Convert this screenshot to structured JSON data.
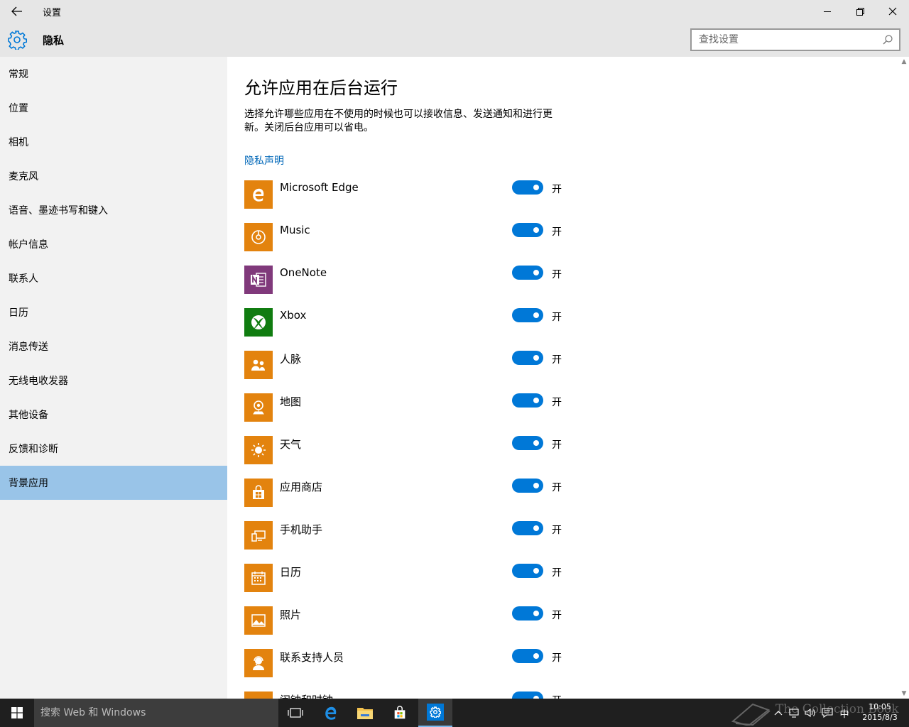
{
  "titlebar": {
    "title": "设置"
  },
  "header": {
    "section_title": "隐私",
    "search_placeholder": "查找设置"
  },
  "sidebar": {
    "items": [
      {
        "label": "常规",
        "active": false
      },
      {
        "label": "位置",
        "active": false
      },
      {
        "label": "相机",
        "active": false
      },
      {
        "label": "麦克风",
        "active": false
      },
      {
        "label": "语音、墨迹书写和键入",
        "active": false
      },
      {
        "label": "帐户信息",
        "active": false
      },
      {
        "label": "联系人",
        "active": false
      },
      {
        "label": "日历",
        "active": false
      },
      {
        "label": "消息传送",
        "active": false
      },
      {
        "label": "无线电收发器",
        "active": false
      },
      {
        "label": "其他设备",
        "active": false
      },
      {
        "label": "反馈和诊断",
        "active": false
      },
      {
        "label": "背景应用",
        "active": true
      }
    ]
  },
  "main": {
    "title": "允许应用在后台运行",
    "description": "选择允许哪些应用在不使用的时候也可以接收信息、发送通知和进行更新。关闭后台应用可以省电。",
    "privacy_link": "隐私声明",
    "on_label": "开",
    "apps": [
      {
        "name": "Microsoft Edge",
        "icon": "edge-icon",
        "color": "#e3830e",
        "on": true
      },
      {
        "name": "Music",
        "icon": "music-icon",
        "color": "#e3830e",
        "on": true
      },
      {
        "name": "OneNote",
        "icon": "onenote-icon",
        "color": "#80397b",
        "on": true
      },
      {
        "name": "Xbox",
        "icon": "xbox-icon",
        "color": "#107c10",
        "on": true
      },
      {
        "name": "人脉",
        "icon": "people-icon",
        "color": "#e3830e",
        "on": true
      },
      {
        "name": "地图",
        "icon": "maps-icon",
        "color": "#e3830e",
        "on": true
      },
      {
        "name": "天气",
        "icon": "weather-icon",
        "color": "#e3830e",
        "on": true
      },
      {
        "name": "应用商店",
        "icon": "store-icon",
        "color": "#e3830e",
        "on": true
      },
      {
        "name": "手机助手",
        "icon": "phone-companion-icon",
        "color": "#e3830e",
        "on": true
      },
      {
        "name": "日历",
        "icon": "calendar-icon",
        "color": "#e3830e",
        "on": true
      },
      {
        "name": "照片",
        "icon": "photos-icon",
        "color": "#e3830e",
        "on": true
      },
      {
        "name": "联系支持人员",
        "icon": "support-icon",
        "color": "#e3830e",
        "on": true
      },
      {
        "name": "闹钟和时钟",
        "icon": "alarms-icon",
        "color": "#e3830e",
        "on": true
      }
    ]
  },
  "taskbar": {
    "search_placeholder": "搜索 Web 和 Windows",
    "time": "10:05",
    "date": "2015/8/3",
    "ime": "中",
    "watermark": "The Collection Book"
  },
  "colors": {
    "accent": "#0078d7",
    "selection": "#99c4e8",
    "link": "#0067b8",
    "app_tile": "#e3830e"
  }
}
